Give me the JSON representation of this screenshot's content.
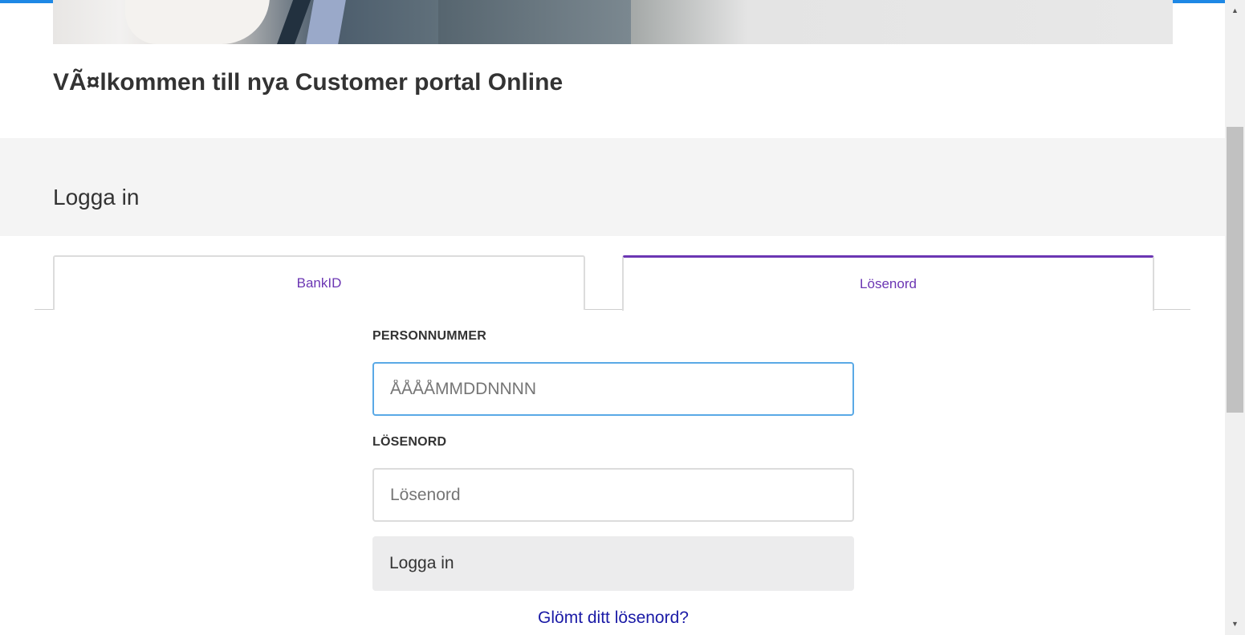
{
  "colors": {
    "accent_top_bar": "#1e88e5",
    "tab_active": "#6b36b3",
    "link": "#1a1aa6",
    "login_band": "#f4f4f4"
  },
  "header": {
    "welcome_title": "VÃ¤lkommen till nya Customer portal Online"
  },
  "login": {
    "heading": "Logga in",
    "tabs": [
      {
        "label": "BankID",
        "active": false
      },
      {
        "label": "Lösenord",
        "active": true
      }
    ],
    "personnummer_label": "PERSONNUMMER",
    "personnummer_placeholder": "ÅÅÅÅMMDDNNNN",
    "password_label": "LÖSENORD",
    "password_placeholder": "Lösenord",
    "submit_label": "Logga in",
    "forgot_link": "Glömt ditt lösenord?"
  },
  "scrollbar": {
    "up_icon": "triangle-up-icon",
    "down_icon": "triangle-down-icon"
  }
}
